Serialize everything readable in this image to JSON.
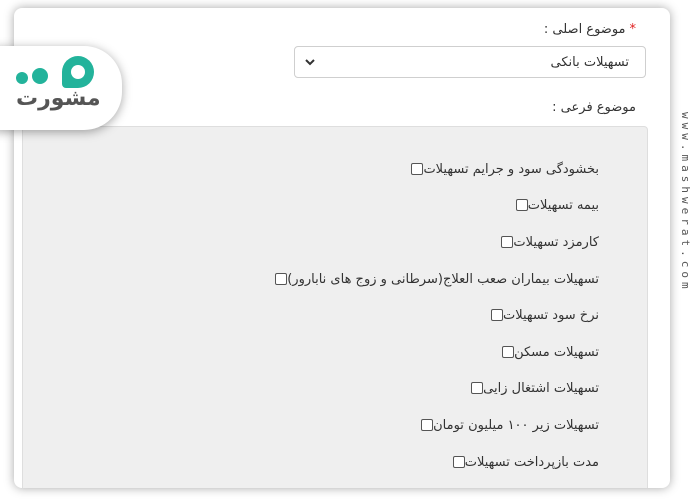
{
  "form": {
    "main_topic": {
      "label": "موضوع اصلی :",
      "required_mark": "*",
      "selected_value": "تسهیلات بانکی"
    },
    "sub_topic": {
      "label": "موضوع فرعی :",
      "options": [
        {
          "label": "بخشودگی سود و جرایم تسهیلات",
          "checked": false
        },
        {
          "label": "بیمه تسهیلات",
          "checked": false
        },
        {
          "label": "کارمزد تسهیلات",
          "checked": false
        },
        {
          "label": "تسهیلات بیماران صعب العلاج(سرطانی و زوج های نابارور)",
          "checked": false
        },
        {
          "label": "نرخ سود تسهیلات",
          "checked": false
        },
        {
          "label": "تسهیلات مسکن",
          "checked": false
        },
        {
          "label": "تسهیلات اشتغال زایی",
          "checked": false
        },
        {
          "label": "تسهیلات زیر ۱۰۰ میلیون تومان",
          "checked": false
        },
        {
          "label": "مدت بازپرداخت تسهیلات",
          "checked": false
        }
      ]
    }
  },
  "branding": {
    "logo_text": "مشورت",
    "watermark_url": "www.mashwerat.com",
    "brand_color": "#23b39b"
  },
  "icons": {
    "select_arrow": "chevron-down-icon"
  }
}
